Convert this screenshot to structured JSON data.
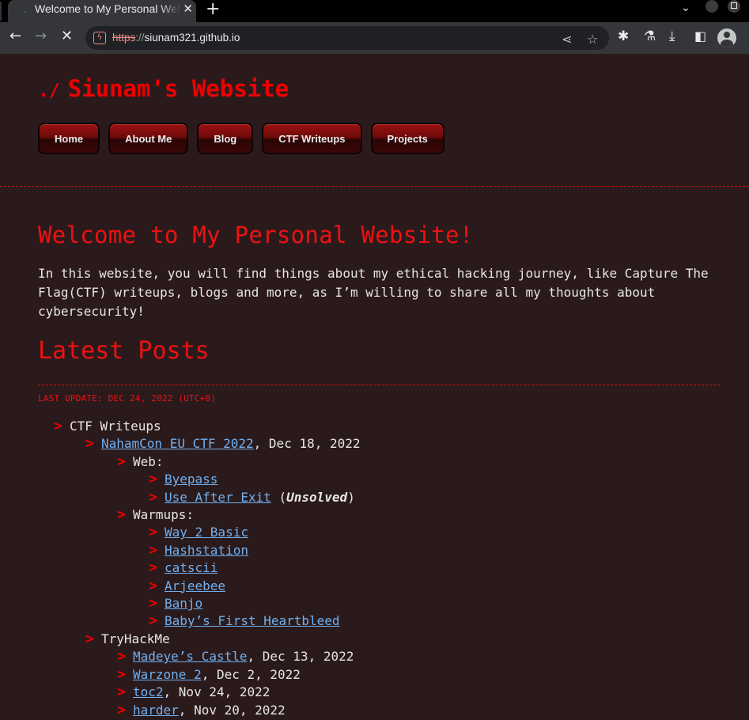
{
  "browser": {
    "tab_title": "Welcome to My Personal Website!",
    "url_scheme": "https",
    "url_separator": "://",
    "url_host": "siunam321.github.io"
  },
  "site": {
    "title_prompt": "./",
    "title": "Siunam's Website",
    "nav": [
      "Home",
      "About Me",
      "Blog",
      "CTF Writeups",
      "Projects"
    ]
  },
  "main": {
    "heading": "Welcome to My Personal Website!",
    "intro": "In this website, you will find things about my ethical hacking journey, like Capture The Flag(CTF) writeups, blogs and more, as I’m willing to share all my thoughts about cybersecurity!",
    "latest_heading": "Latest Posts",
    "last_update": "LAST UPDATE: DEC 24, 2022 (UTC+8)"
  },
  "posts": {
    "ctf_label": "CTF Writeups",
    "nahamcon": {
      "link": "NahamCon EU CTF 2022",
      "date": ", Dec 18, 2022"
    },
    "web_label": "Web:",
    "byepass": "Byepass",
    "use_after_exit": "Use After Exit",
    "use_after_exit_open": " (",
    "unsolved": "Unsolved",
    "use_after_exit_close": ")",
    "warmups_label": "Warmups:",
    "warmups": [
      "Way 2 Basic",
      "Hashstation",
      "catscii",
      "Arjeebee",
      "Banjo",
      "Baby’s First Heartbleed"
    ],
    "tryhackme_label": "TryHackMe",
    "thm": [
      {
        "link": "Madeye’s Castle",
        "date": ", Dec 13, 2022"
      },
      {
        "link": "Warzone 2",
        "date": ", Dec 2, 2022"
      },
      {
        "link": "toc2",
        "date": ", Nov 24, 2022"
      },
      {
        "link": "harder",
        "date": ", Nov 20, 2022"
      }
    ]
  }
}
